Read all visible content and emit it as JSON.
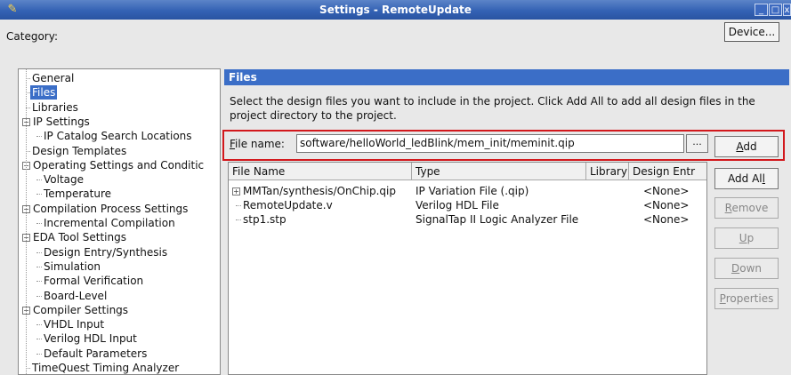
{
  "window": {
    "title": "Settings - RemoteUpdate",
    "minimize_icon": "minimize-icon",
    "maximize_icon": "maximize-icon",
    "close_icon": "close-icon"
  },
  "category_label": "Category:",
  "device_button": "Device...",
  "tree": [
    {
      "label": "General",
      "level": 1,
      "expander": null,
      "selected": false
    },
    {
      "label": "Files",
      "level": 1,
      "expander": null,
      "selected": true
    },
    {
      "label": "Libraries",
      "level": 1,
      "expander": null,
      "selected": false
    },
    {
      "label": "IP Settings",
      "level": 0,
      "expander": "minus",
      "selected": false
    },
    {
      "label": "IP Catalog Search Locations",
      "level": 2,
      "expander": null,
      "selected": false
    },
    {
      "label": "Design Templates",
      "level": 1,
      "expander": null,
      "selected": false
    },
    {
      "label": "Operating Settings and Conditic",
      "level": 0,
      "expander": "minus",
      "selected": false
    },
    {
      "label": "Voltage",
      "level": 2,
      "expander": null,
      "selected": false
    },
    {
      "label": "Temperature",
      "level": 2,
      "expander": null,
      "selected": false
    },
    {
      "label": "Compilation Process Settings",
      "level": 0,
      "expander": "minus",
      "selected": false
    },
    {
      "label": "Incremental Compilation",
      "level": 2,
      "expander": null,
      "selected": false
    },
    {
      "label": "EDA Tool Settings",
      "level": 0,
      "expander": "minus",
      "selected": false
    },
    {
      "label": "Design Entry/Synthesis",
      "level": 2,
      "expander": null,
      "selected": false
    },
    {
      "label": "Simulation",
      "level": 2,
      "expander": null,
      "selected": false
    },
    {
      "label": "Formal Verification",
      "level": 2,
      "expander": null,
      "selected": false
    },
    {
      "label": "Board-Level",
      "level": 2,
      "expander": null,
      "selected": false
    },
    {
      "label": "Compiler Settings",
      "level": 0,
      "expander": "minus",
      "selected": false
    },
    {
      "label": "VHDL Input",
      "level": 2,
      "expander": null,
      "selected": false
    },
    {
      "label": "Verilog HDL Input",
      "level": 2,
      "expander": null,
      "selected": false
    },
    {
      "label": "Default Parameters",
      "level": 2,
      "expander": null,
      "selected": false
    },
    {
      "label": "TimeQuest Timing Analyzer",
      "level": 1,
      "expander": null,
      "selected": false
    }
  ],
  "panel": {
    "title": "Files",
    "description": "Select the design files you want to include in the project. Click Add All to add all design files in the project directory to the project.",
    "file_name_label": "File name:",
    "file_name_value": "software/helloWorld_ledBlink/mem_init/meminit.qip",
    "browse_label": "...",
    "table_headers": [
      "File Name",
      "Type",
      "Library",
      "Design Entr"
    ],
    "rows": [
      {
        "name": "MMTan/synthesis/OnChip.qip",
        "type": "IP Variation File (.qip)",
        "library": "",
        "design_entry": "<None>",
        "expander": "plus"
      },
      {
        "name": "RemoteUpdate.v",
        "type": "Verilog HDL File",
        "library": "",
        "design_entry": "<None>",
        "expander": null
      },
      {
        "name": "stp1.stp",
        "type": "SignalTap II Logic Analyzer File",
        "library": "",
        "design_entry": "<None>",
        "expander": null
      }
    ],
    "buttons": {
      "add": "Add",
      "add_all": "Add All",
      "remove": "Remove",
      "up": "Up",
      "down": "Down",
      "properties": "Properties"
    }
  },
  "colors": {
    "title_bar": "#3462b4",
    "selection": "#3b6ec7",
    "highlight_box": "#d2181c"
  }
}
